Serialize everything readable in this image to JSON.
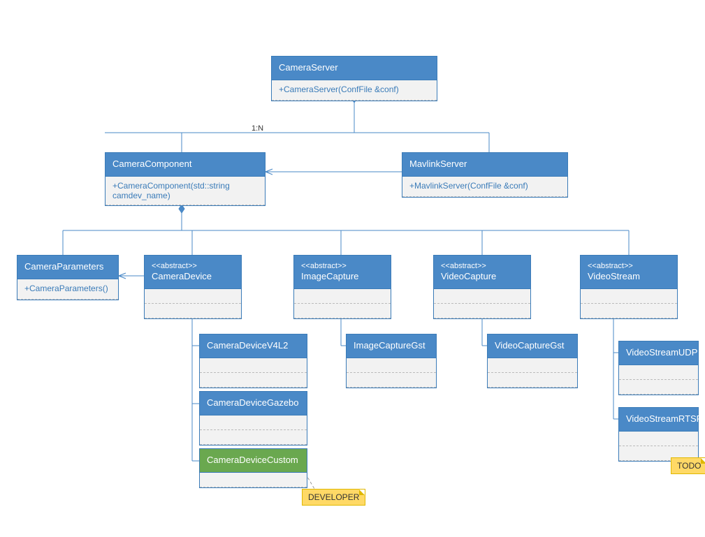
{
  "classes": {
    "camera_server": {
      "title": "CameraServer",
      "method": "+CameraServer(ConfFile &conf)"
    },
    "camera_component": {
      "title": "CameraComponent",
      "method": "+CameraComponent(std::string camdev_name)"
    },
    "mavlink_server": {
      "title": "MavlinkServer",
      "method": "+MavlinkServer(ConfFile &conf)"
    },
    "camera_parameters": {
      "title": "CameraParameters",
      "method": "+CameraParameters()"
    },
    "camera_device": {
      "stereo": "<<abstract>>",
      "title": "CameraDevice"
    },
    "image_capture": {
      "stereo": "<<abstract>>",
      "title": "ImageCapture"
    },
    "video_capture": {
      "stereo": "<<abstract>>",
      "title": "VideoCapture"
    },
    "video_stream": {
      "stereo": "<<abstract>>",
      "title": "VideoStream"
    },
    "camera_device_v4l2": {
      "title": "CameraDeviceV4L2"
    },
    "camera_device_gazebo": {
      "title": "CameraDeviceGazebo"
    },
    "camera_device_custom": {
      "title": "CameraDeviceCustom"
    },
    "image_capture_gst": {
      "title": "ImageCaptureGst"
    },
    "video_capture_gst": {
      "title": "VideoCaptureGst"
    },
    "video_stream_udp": {
      "title": "VideoStreamUDP"
    },
    "video_stream_rtsp": {
      "title": "VideoStreamRTSP"
    }
  },
  "notes": {
    "developer": "DEVELOPER",
    "todo": "TODO"
  },
  "labels": {
    "one_to_n": "1:N"
  }
}
